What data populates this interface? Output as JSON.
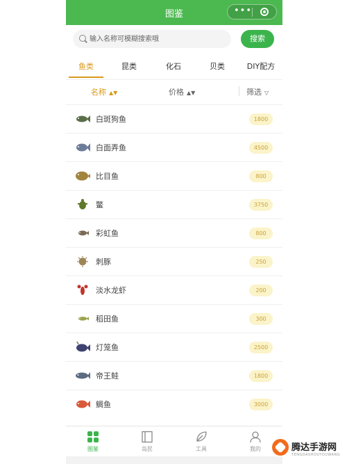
{
  "header": {
    "title": "图鉴",
    "more_glyph": "•••",
    "accent": "#4cb850"
  },
  "search": {
    "placeholder": "输入名称可模糊搜索哦",
    "button_label": "搜索"
  },
  "tabs": [
    {
      "label": "鱼类",
      "active": true
    },
    {
      "label": "昆类",
      "active": false
    },
    {
      "label": "化石",
      "active": false
    },
    {
      "label": "贝类",
      "active": false
    },
    {
      "label": "DIY配方",
      "active": false
    }
  ],
  "sort": {
    "name": "名称",
    "price": "价格",
    "filter": "筛选",
    "sort_arrows": "▲▼",
    "filter_glyph": "▽"
  },
  "items": [
    {
      "name": "白斑狗鱼",
      "price": "1800",
      "icon": "fish-icon",
      "color": "#5a6e4a"
    },
    {
      "name": "白面弄鱼",
      "price": "4500",
      "icon": "fish-icon",
      "color": "#6d7c99"
    },
    {
      "name": "比目鱼",
      "price": "800",
      "icon": "flatfish-icon",
      "color": "#a2843d"
    },
    {
      "name": "鳖",
      "price": "3750",
      "icon": "turtle-icon",
      "color": "#5f7a2a"
    },
    {
      "name": "彩虹鱼",
      "price": "800",
      "icon": "fish-icon",
      "color": "#7b6a55"
    },
    {
      "name": "刺豚",
      "price": "250",
      "icon": "pufferfish-icon",
      "color": "#9c8656"
    },
    {
      "name": "淡水龙虾",
      "price": "200",
      "icon": "crayfish-icon",
      "color": "#c0352b"
    },
    {
      "name": "稻田鱼",
      "price": "300",
      "icon": "fish-icon",
      "color": "#9aa24a"
    },
    {
      "name": "灯笼鱼",
      "price": "2500",
      "icon": "fish-icon",
      "color": "#3e4270"
    },
    {
      "name": "帝王鲑",
      "price": "1800",
      "icon": "fish-icon",
      "color": "#5b6b80"
    },
    {
      "name": "鲷鱼",
      "price": "3000",
      "icon": "fish-icon",
      "color": "#d9593a"
    }
  ],
  "nav": [
    {
      "label": "图鉴",
      "icon": "grid-icon",
      "active": true
    },
    {
      "label": "岛民",
      "icon": "book-icon",
      "active": false
    },
    {
      "label": "工具",
      "icon": "leaf-icon",
      "active": false
    },
    {
      "label": "我的",
      "icon": "user-icon",
      "active": false
    }
  ],
  "watermark": {
    "text": "腾达手游网",
    "sub": "TENGDASHOUYOUWANG"
  }
}
